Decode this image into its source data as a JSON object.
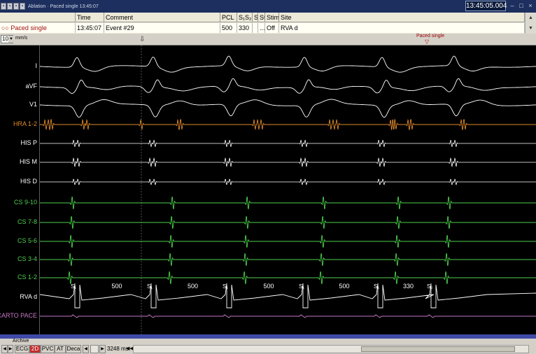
{
  "window": {
    "title": "Ablation · Paced single  13:45:07",
    "clock": "13:45:05.004",
    "controls": [
      "–",
      "□",
      "×"
    ]
  },
  "event_table": {
    "close_glyph": "×",
    "headers": {
      "time": "Time",
      "comment": "Comment",
      "pcl": "PCL",
      "s1s2": "S₁S₂",
      "s": "S",
      "st": "St",
      "stim": "Stim",
      "site": "Site"
    },
    "row": {
      "label": "Paced single",
      "time": "13:45:07",
      "comment": "Event #29",
      "pcl": "500",
      "s1s2": "330",
      "s": "",
      "st": "....",
      "stim": "Off",
      "site": "RVA d"
    },
    "scroll_up": "▲",
    "scroll_down": "▼"
  },
  "toolbar": {
    "speed_value": "100",
    "speed_unit": "mm/s",
    "event_flag_label": "Paced single",
    "event_flag_glyph": "▽",
    "cursor_glyph": "⇩"
  },
  "channels": [
    {
      "label": "I",
      "color": "#ffffff"
    },
    {
      "label": "aVF",
      "color": "#ffffff"
    },
    {
      "label": "V1",
      "color": "#ffffff"
    },
    {
      "label": "HRA 1-2",
      "color": "#e08a2a"
    },
    {
      "label": "HIS P",
      "color": "#ffffff"
    },
    {
      "label": "HIS M",
      "color": "#ffffff"
    },
    {
      "label": "HIS D",
      "color": "#ffffff"
    },
    {
      "label": "CS 9-10",
      "color": "#4ed04e"
    },
    {
      "label": "CS 7-8",
      "color": "#4ed04e"
    },
    {
      "label": "CS 5-6",
      "color": "#4ed04e"
    },
    {
      "label": "CS 3-4",
      "color": "#4ed04e"
    },
    {
      "label": "CS 1-2",
      "color": "#4ed04e"
    },
    {
      "label": "RVA d",
      "color": "#ffffff"
    },
    {
      "label": "CARTO PACE",
      "color": "#c878c8"
    }
  ],
  "stim_annotations": {
    "markers": [
      "S₁",
      "S₁",
      "S₁",
      "S₁",
      "S₁",
      "S₂"
    ],
    "intervals": [
      "500",
      "500",
      "500",
      "500",
      "330"
    ]
  },
  "bottom": {
    "archive_label": "Archive",
    "tabs": [
      {
        "label": "ECG",
        "active": false
      },
      {
        "label": "2D",
        "active": true
      },
      {
        "label": "PVC",
        "active": false
      },
      {
        "label": "AT",
        "active": false
      },
      {
        "label": "Deca",
        "active": false
      }
    ],
    "nav": [
      "◀",
      "▶",
      "◀",
      "▶"
    ],
    "duration": "3248 ms",
    "rewind_glyph": "◀◀"
  },
  "colors": {
    "ecg": "#ffffff",
    "hra": "#e08a2a",
    "cs": "#4ed04e",
    "carto": "#c878c8",
    "title_bar": "#1c2f5e",
    "scroll_strip": "#3f4aa8",
    "active_tab": "#c32b2b"
  }
}
